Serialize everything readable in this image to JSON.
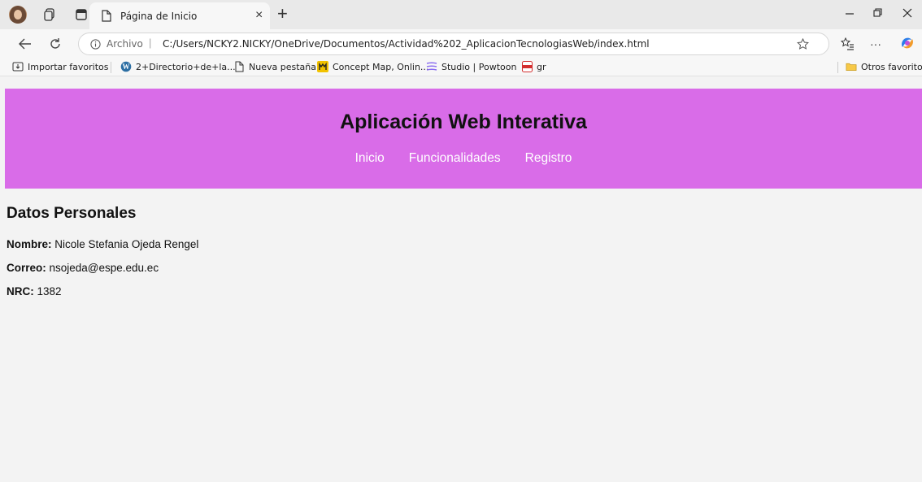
{
  "browser": {
    "tab_title": "Página de Inicio",
    "new_tab_symbol": "+",
    "close_symbol": "×",
    "url_prefix": "Archivo",
    "url": "C:/Users/NCKY2.NICKY/OneDrive/Documentos/Actividad%202_AplicacionTecnologiasWeb/index.html",
    "bookmarks": [
      {
        "label": "Importar favoritos",
        "icon": "import-icon"
      },
      {
        "label": "2+Directorio+de+la...",
        "icon": "wordpress-icon"
      },
      {
        "label": "Nueva pestaña",
        "icon": "page-icon"
      },
      {
        "label": "Concept Map, Onlin...",
        "icon": "conceptmap-icon"
      },
      {
        "label": "Studio | Powtoon",
        "icon": "powtoon-icon"
      },
      {
        "label": "gr",
        "icon": "pdf-icon"
      }
    ],
    "other_favorites": "Otros favoritos",
    "colors": {
      "tabbar": "#e9e9e9",
      "toolbar": "#f7f7f7"
    }
  },
  "page": {
    "title": "Aplicación Web Interativa",
    "nav": [
      "Inicio",
      "Funcionalidades",
      "Registro"
    ],
    "section_title": "Datos Personales",
    "fields": [
      {
        "label": "Nombre:",
        "value": " Nicole Stefania Ojeda Rengel"
      },
      {
        "label": "Correo:",
        "value": " nsojeda@espe.edu.ec"
      },
      {
        "label": "NRC:",
        "value": " 1382"
      }
    ],
    "colors": {
      "header_bg": "#d96ce8",
      "nav_text": "#ffffff",
      "body_bg": "#f3f3f3"
    }
  }
}
